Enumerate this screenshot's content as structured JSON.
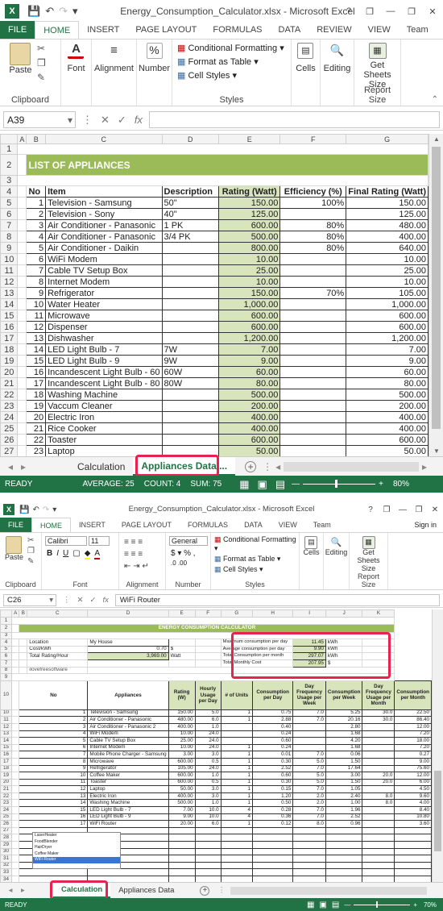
{
  "w1": {
    "title": "Energy_Consumption_Calculator.xlsx - Microsoft Excel",
    "tabs": [
      "FILE",
      "HOME",
      "INSERT",
      "PAGE LAYOUT",
      "FORMULAS",
      "DATA",
      "REVIEW",
      "VIEW",
      "Team"
    ],
    "ribbon": {
      "clipboard": {
        "paste": "Paste",
        "label": "Clipboard"
      },
      "font": "Font",
      "alignment": "Alignment",
      "number": "Number",
      "styles": {
        "cf": "Conditional Formatting",
        "fat": "Format as Table",
        "cs": "Cell Styles",
        "label": "Styles"
      },
      "cells": "Cells",
      "editing": "Editing",
      "report": {
        "btn": "Get Sheets Size",
        "label": "Report Size"
      }
    },
    "namebox": "A39",
    "fx": "fx",
    "cols": [
      "A",
      "B",
      "C",
      "D",
      "E",
      "F",
      "G"
    ],
    "sheet_title": "LIST OF APPLIANCES",
    "headers": [
      "No",
      "Item",
      "Description",
      "Rating (Watt)",
      "Efficiency (%)",
      "Final Rating (Watt)"
    ],
    "rows": [
      [
        "1",
        "Television - Samsung",
        "50\"",
        "150.00",
        "100%",
        "150.00"
      ],
      [
        "2",
        "Television - Sony",
        "40\"",
        "125.00",
        "",
        "125.00"
      ],
      [
        "3",
        "Air Conditioner - Panasonic",
        "1 PK",
        "600.00",
        "80%",
        "480.00"
      ],
      [
        "4",
        "Air Conditioner - Panasonic",
        "3/4 PK",
        "500.00",
        "80%",
        "400.00"
      ],
      [
        "5",
        "Air Conditioner - Daikin",
        "",
        "800.00",
        "80%",
        "640.00"
      ],
      [
        "6",
        "WiFi Modem",
        "",
        "10.00",
        "",
        "10.00"
      ],
      [
        "7",
        "Cable TV Setup Box",
        "",
        "25.00",
        "",
        "25.00"
      ],
      [
        "8",
        "Internet Modem",
        "",
        "10.00",
        "",
        "10.00"
      ],
      [
        "9",
        "Refrigerator",
        "",
        "150.00",
        "70%",
        "105.00"
      ],
      [
        "10",
        "Water Heater",
        "",
        "1,000.00",
        "",
        "1,000.00"
      ],
      [
        "11",
        "Microwave",
        "",
        "600.00",
        "",
        "600.00"
      ],
      [
        "12",
        "Dispenser",
        "",
        "600.00",
        "",
        "600.00"
      ],
      [
        "13",
        "Dishwasher",
        "",
        "1,200.00",
        "",
        "1,200.00"
      ],
      [
        "14",
        "LED Light Bulb - 7",
        "7W",
        "7.00",
        "",
        "7.00"
      ],
      [
        "15",
        "LED Light Bulb - 9",
        "9W",
        "9.00",
        "",
        "9.00"
      ],
      [
        "16",
        "Incandescent Light Bulb - 60",
        "60W",
        "60.00",
        "",
        "60.00"
      ],
      [
        "17",
        "Incandescent Light Bulb - 80",
        "80W",
        "80.00",
        "",
        "80.00"
      ],
      [
        "18",
        "Washing Machine",
        "",
        "500.00",
        "",
        "500.00"
      ],
      [
        "19",
        "Vaccum Cleaner",
        "",
        "200.00",
        "",
        "200.00"
      ],
      [
        "20",
        "Electric Iron",
        "",
        "400.00",
        "",
        "400.00"
      ],
      [
        "21",
        "Rice Cooker",
        "",
        "400.00",
        "",
        "400.00"
      ],
      [
        "22",
        "Toaster",
        "",
        "600.00",
        "",
        "600.00"
      ],
      [
        "23",
        "Laptop",
        "",
        "50.00",
        "",
        "50.00"
      ]
    ],
    "sheets": [
      "Calculation",
      "Appliances Data"
    ],
    "sheet_more": "...",
    "status": {
      "ready": "READY",
      "avg": "AVERAGE: 25",
      "count": "COUNT: 4",
      "sum": "SUM: 75",
      "zoom": "80%"
    }
  },
  "w2": {
    "title": "Energy_Consumption_Calculator.xlsx - Microsoft Excel",
    "tabs": [
      "FILE",
      "HOME",
      "INSERT",
      "PAGE LAYOUT",
      "FORMULAS",
      "DATA",
      "VIEW",
      "Team"
    ],
    "signin": "Sign in",
    "ribbon": {
      "font_name": "Calibri",
      "font_size": "11",
      "number_format": "General",
      "clipboard": {
        "paste": "Paste",
        "label": "Clipboard"
      },
      "font": "Font",
      "alignment": "Alignment",
      "number": "Number",
      "styles": {
        "cf": "Conditional Formatting",
        "fat": "Format as Table",
        "cs": "Cell Styles",
        "label": "Styles"
      },
      "cells": "Cells",
      "editing": "Editing",
      "report": {
        "btn": "Get Sheets Size",
        "label": "Report Size"
      }
    },
    "namebox": "C26",
    "fx": "fx",
    "formula": "WiFi Router",
    "cols": [
      "A",
      "B",
      "C",
      "D",
      "E",
      "F",
      "G",
      "H",
      "I",
      "J",
      "K"
    ],
    "calc_title": "ENERGY CONSUMPTION CALCULATOR",
    "info": {
      "location_label": "Location",
      "location": "My House",
      "cost_label": "Cost/kWh",
      "cost": "0.70",
      "cost_unit": "$",
      "total_label": "Total Rating/Hour",
      "total": "3,969.00",
      "total_unit": "Watt",
      "credit": "ilovefreesoftware"
    },
    "summary": [
      {
        "label": "Maximum consumption per day",
        "value": "11.45",
        "unit": "kWh"
      },
      {
        "label": "Average consumption per day",
        "value": "9.90",
        "unit": "kWh"
      },
      {
        "label": "Total Consumption per month",
        "value": "297.07",
        "unit": "kWh"
      },
      {
        "label": "Total Monthly Cost",
        "value": "207.95",
        "unit": "$"
      }
    ],
    "headers": [
      "No",
      "Appliances",
      "Rating (W)",
      "Hourly Usage per Day",
      "# of Units",
      "Consumption per Day",
      "Day Frequency Usage per Week",
      "Consumption per Week",
      "Day Frequency Usage per Month",
      "Consumption per Month"
    ],
    "rows": [
      [
        "1",
        "Television - Samsung",
        "150.00",
        "5.0",
        "1",
        "0.75",
        "7.0",
        "5.25",
        "30.0",
        "22.50"
      ],
      [
        "2",
        "Air Conditioner - Panasonic",
        "480.00",
        "6.0",
        "1",
        "2.88",
        "7.0",
        "20.16",
        "30.0",
        "86.40"
      ],
      [
        "3",
        "Air Conditioner - Panasonic 2",
        "400.00",
        "1.0",
        "",
        "0.40",
        "",
        "2.80",
        "",
        "12.00"
      ],
      [
        "4",
        "WiFi Modem",
        "10.00",
        "24.0",
        "",
        "0.24",
        "",
        "1.68",
        "",
        "7.20"
      ],
      [
        "5",
        "Cable TV Setup Box",
        "25.00",
        "24.0",
        "",
        "0.60",
        "",
        "4.20",
        "",
        "18.00"
      ],
      [
        "6",
        "Internet Modem",
        "10.00",
        "24.0",
        "1",
        "0.24",
        "",
        "1.68",
        "",
        "7.20"
      ],
      [
        "7",
        "Mobile Phone Charger - Samsung",
        "3.00",
        "3.0",
        "1",
        "0.01",
        "7.0",
        "0.06",
        "",
        "0.27"
      ],
      [
        "8",
        "Microwave",
        "600.00",
        "0.5",
        "1",
        "0.30",
        "5.0",
        "1.50",
        "",
        "9.00"
      ],
      [
        "9",
        "Refrigerator",
        "105.00",
        "24.0",
        "1",
        "2.52",
        "7.0",
        "17.64",
        "",
        "75.60"
      ],
      [
        "10",
        "Coffee Maker",
        "600.00",
        "1.0",
        "1",
        "0.60",
        "5.0",
        "3.00",
        "20.0",
        "12.00"
      ],
      [
        "11",
        "Toaster",
        "600.00",
        "0.5",
        "1",
        "0.30",
        "5.0",
        "1.50",
        "20.0",
        "6.00"
      ],
      [
        "12",
        "Laptop",
        "50.00",
        "3.0",
        "1",
        "0.15",
        "7.0",
        "1.05",
        "",
        "4.50"
      ],
      [
        "13",
        "Electric Iron",
        "400.00",
        "3.0",
        "1",
        "1.20",
        "2.0",
        "2.40",
        "8.0",
        "9.60"
      ],
      [
        "14",
        "Washing Machine",
        "500.00",
        "1.0",
        "1",
        "0.50",
        "2.0",
        "1.00",
        "8.0",
        "4.00"
      ],
      [
        "15",
        "LED Light Bulb - 7",
        "7.00",
        "10.0",
        "4",
        "0.28",
        "7.0",
        "1.96",
        "",
        "8.40"
      ],
      [
        "16",
        "LED Light Bulb - 9",
        "9.00",
        "10.0",
        "4",
        "0.36",
        "7.0",
        "2.52",
        "",
        "10.80"
      ],
      [
        "17",
        "WiFi Router",
        "20.00",
        "6.0",
        "1",
        "0.12",
        "8.0",
        "0.96",
        "",
        "3.60"
      ]
    ],
    "dropdown": [
      "LaserHeater",
      "FoodBlender",
      "HairDryer",
      "Coffee Maker",
      "WiFi Router"
    ],
    "sheets": [
      "Calculation",
      "Appliances Data"
    ],
    "status": {
      "ready": "READY",
      "zoom": "70%"
    }
  }
}
